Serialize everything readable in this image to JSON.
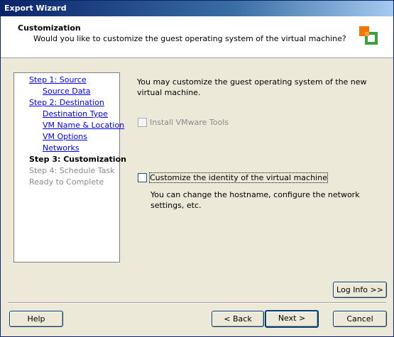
{
  "window": {
    "title": "Export Wizard"
  },
  "header": {
    "title": "Customization",
    "subtitle": "Would you like to customize the guest operating system of the virtual machine?"
  },
  "nav": {
    "step1": "Step 1: Source",
    "source_data": "Source Data",
    "step2": "Step 2: Destination",
    "destination_type": "Destination Type",
    "vm_name_location": "VM Name & Location",
    "vm_options": "VM Options",
    "networks": "Networks",
    "step3": "Step 3: Customization",
    "step4": "Step 4: Schedule Task",
    "ready": "Ready to Complete"
  },
  "content": {
    "intro": "You may customize the guest operating system of the new virtual machine.",
    "install_tools_label": "Install VMware Tools",
    "install_tools_checked": false,
    "install_tools_enabled": false,
    "customize_label": "Customize the identity of the virtual machine",
    "customize_checked": false,
    "customize_desc": "You can change the hostname, configure the network settings, etc."
  },
  "buttons": {
    "log_info": "Log Info >>",
    "help": "Help",
    "back": "< Back",
    "next": "Next >",
    "cancel": "Cancel"
  }
}
